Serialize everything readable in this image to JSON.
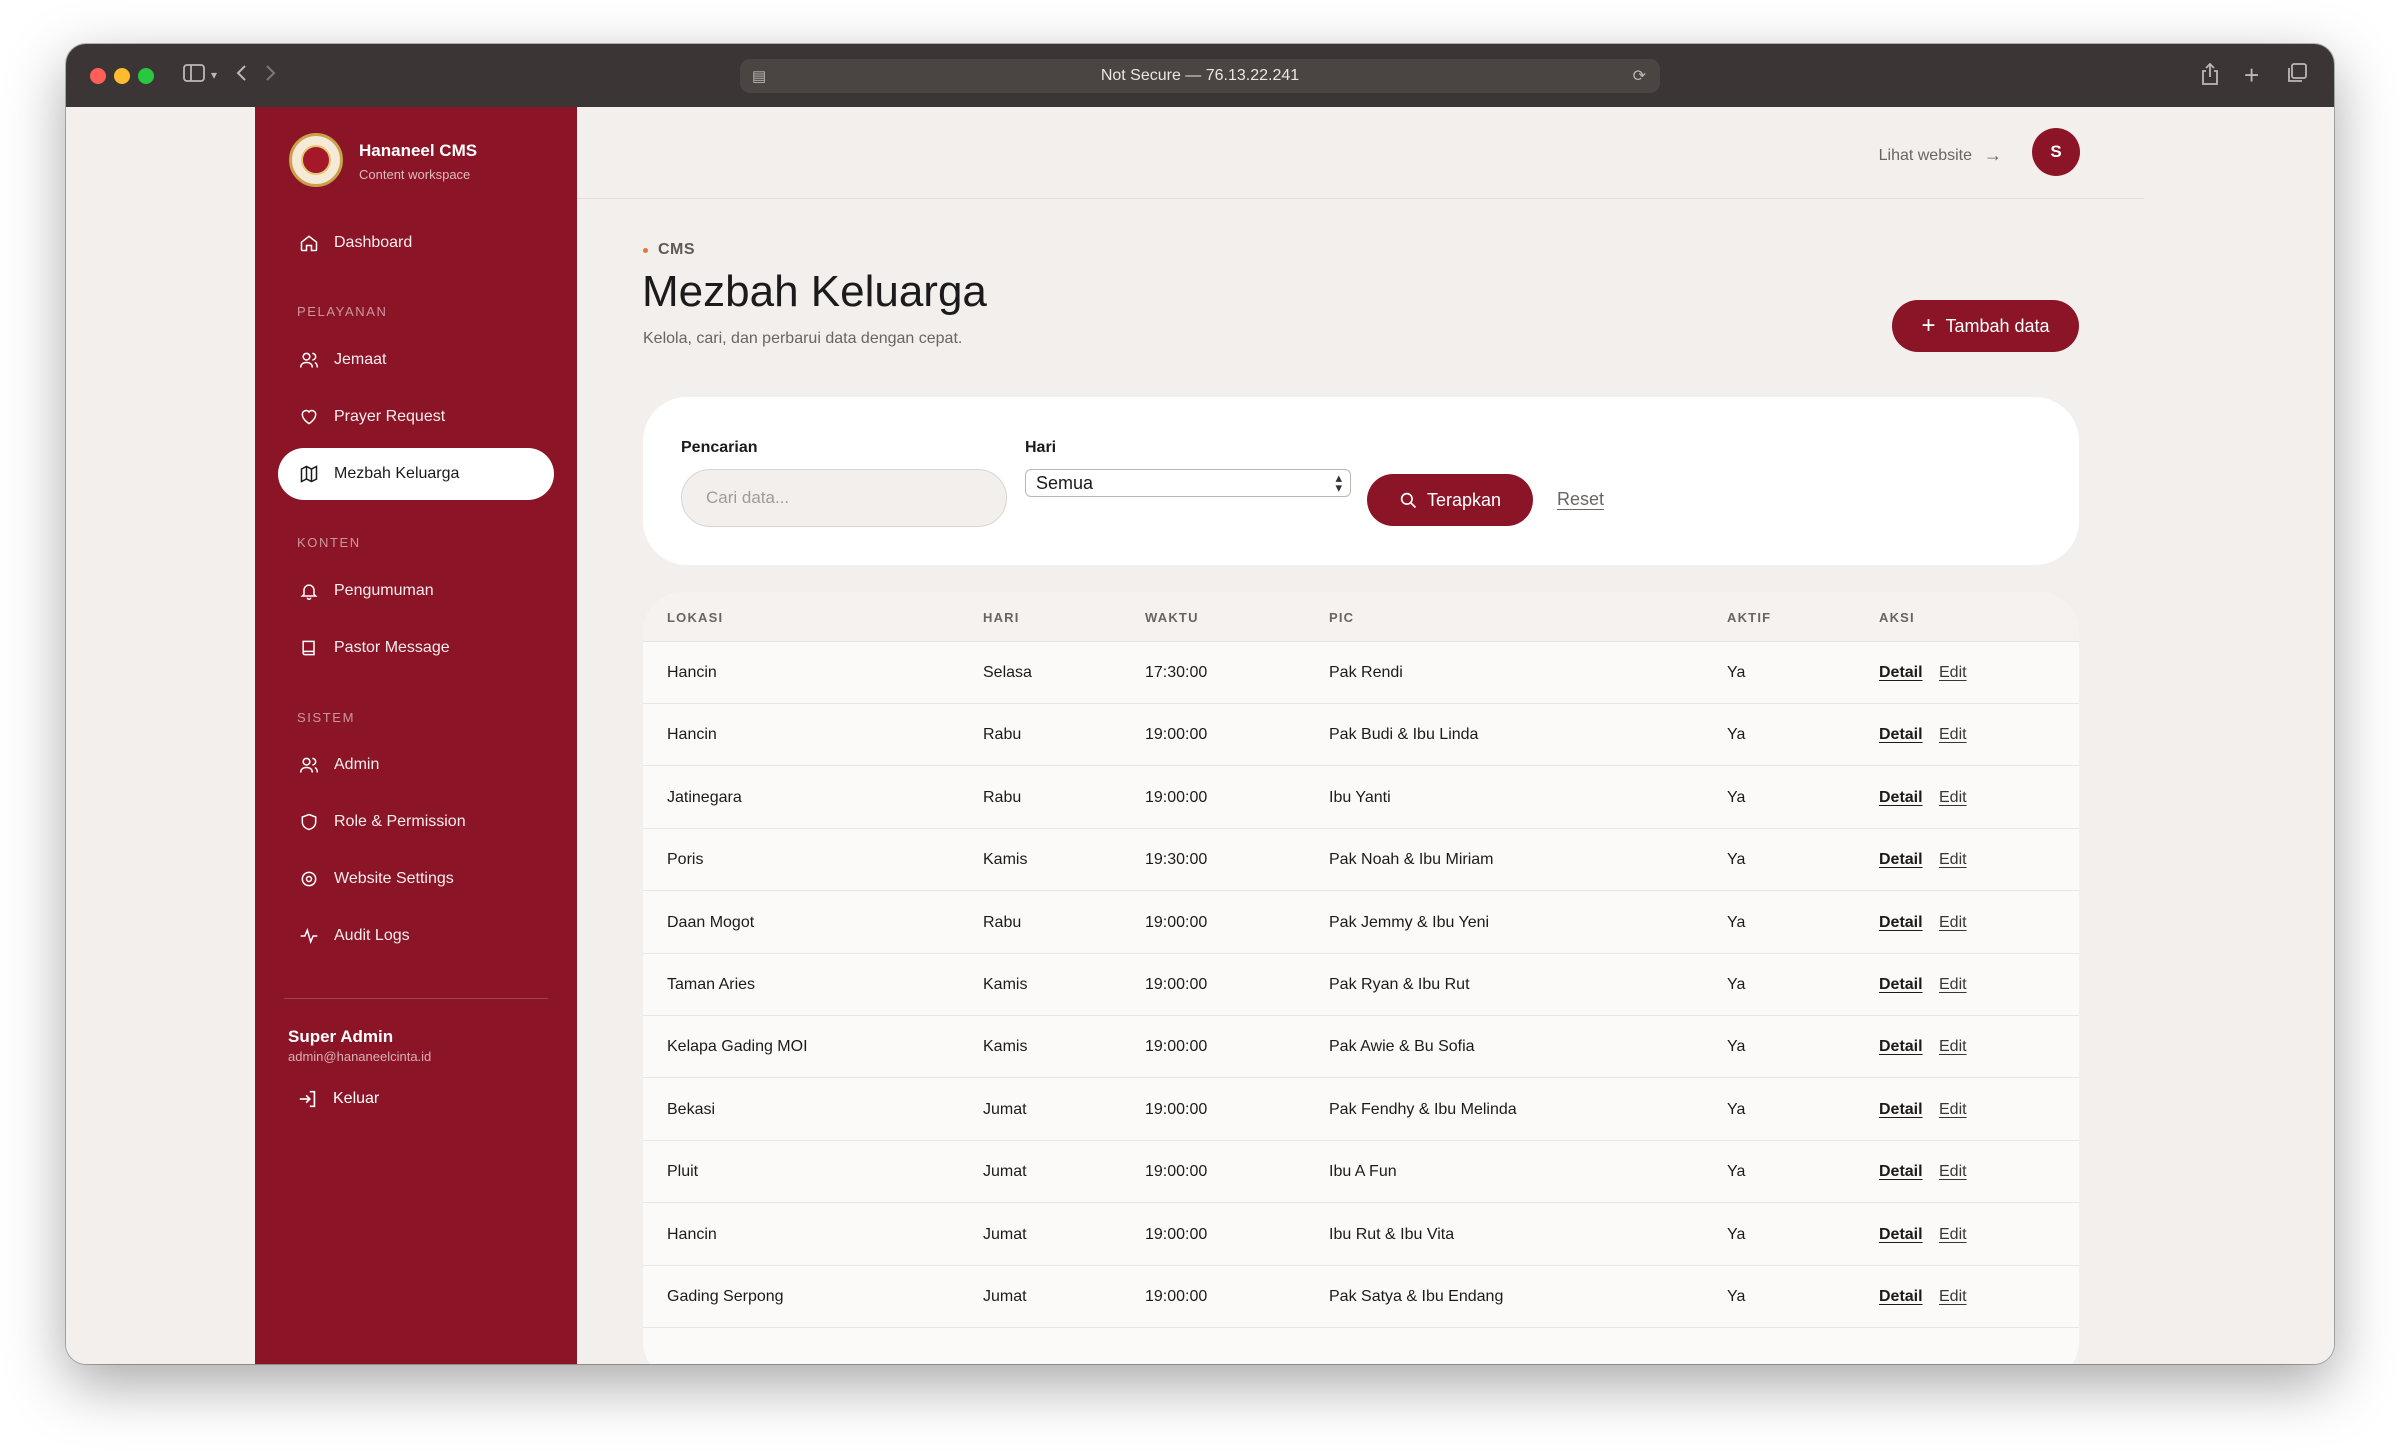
{
  "browser": {
    "url": "Not Secure — 76.13.22.241"
  },
  "brand": {
    "title": "Hananeel CMS",
    "subtitle": "Content workspace"
  },
  "sidebar": {
    "dashboard": "Dashboard",
    "sections": {
      "pelayanan": "PELAYANAN",
      "konten": "KONTEN",
      "sistem": "SISTEM"
    },
    "items": {
      "jemaat": "Jemaat",
      "prayer": "Prayer Request",
      "mezbah": "Mezbah Keluarga",
      "pengumuman": "Pengumuman",
      "pastor": "Pastor Message",
      "admin": "Admin",
      "role": "Role & Permission",
      "settings": "Website Settings",
      "audit": "Audit Logs"
    },
    "user": {
      "name": "Super Admin",
      "email": "admin@hananeelcinta.id"
    },
    "logout": "Keluar"
  },
  "topbar": {
    "visit_website": "Lihat website",
    "avatar_initial": "S"
  },
  "page": {
    "eyebrow": "CMS",
    "title": "Mezbah Keluarga",
    "subtitle": "Kelola, cari, dan perbarui data dengan cepat.",
    "add_button": "Tambah data"
  },
  "filter": {
    "search_label": "Pencarian",
    "search_placeholder": "Cari data...",
    "day_label": "Hari",
    "day_value": "Semua",
    "apply": "Terapkan",
    "reset": "Reset"
  },
  "table": {
    "headers": [
      "LOKASI",
      "HARI",
      "WAKTU",
      "PIC",
      "AKTIF",
      "AKSI"
    ],
    "detail_label": "Detail",
    "edit_label": "Edit",
    "rows": [
      {
        "lokasi": "Hancin",
        "hari": "Selasa",
        "waktu": "17:30:00",
        "pic": "Pak Rendi",
        "aktif": "Ya"
      },
      {
        "lokasi": "Hancin",
        "hari": "Rabu",
        "waktu": "19:00:00",
        "pic": "Pak Budi & Ibu Linda",
        "aktif": "Ya"
      },
      {
        "lokasi": "Jatinegara",
        "hari": "Rabu",
        "waktu": "19:00:00",
        "pic": "Ibu Yanti",
        "aktif": "Ya"
      },
      {
        "lokasi": "Poris",
        "hari": "Kamis",
        "waktu": "19:30:00",
        "pic": "Pak Noah & Ibu Miriam",
        "aktif": "Ya"
      },
      {
        "lokasi": "Daan Mogot",
        "hari": "Rabu",
        "waktu": "19:00:00",
        "pic": "Pak Jemmy & Ibu Yeni",
        "aktif": "Ya"
      },
      {
        "lokasi": "Taman Aries",
        "hari": "Kamis",
        "waktu": "19:00:00",
        "pic": "Pak Ryan & Ibu Rut",
        "aktif": "Ya"
      },
      {
        "lokasi": "Kelapa Gading MOI",
        "hari": "Kamis",
        "waktu": "19:00:00",
        "pic": "Pak Awie & Bu Sofia",
        "aktif": "Ya"
      },
      {
        "lokasi": "Bekasi",
        "hari": "Jumat",
        "waktu": "19:00:00",
        "pic": "Pak Fendhy & Ibu Melinda",
        "aktif": "Ya"
      },
      {
        "lokasi": "Pluit",
        "hari": "Jumat",
        "waktu": "19:00:00",
        "pic": "Ibu A Fun",
        "aktif": "Ya"
      },
      {
        "lokasi": "Hancin",
        "hari": "Jumat",
        "waktu": "19:00:00",
        "pic": "Ibu Rut & Ibu Vita",
        "aktif": "Ya"
      },
      {
        "lokasi": "Gading Serpong",
        "hari": "Jumat",
        "waktu": "19:00:00",
        "pic": "Pak Satya & Ibu Endang",
        "aktif": "Ya"
      }
    ]
  },
  "colors": {
    "brand": "#8b1527",
    "background": "#f2efec"
  }
}
